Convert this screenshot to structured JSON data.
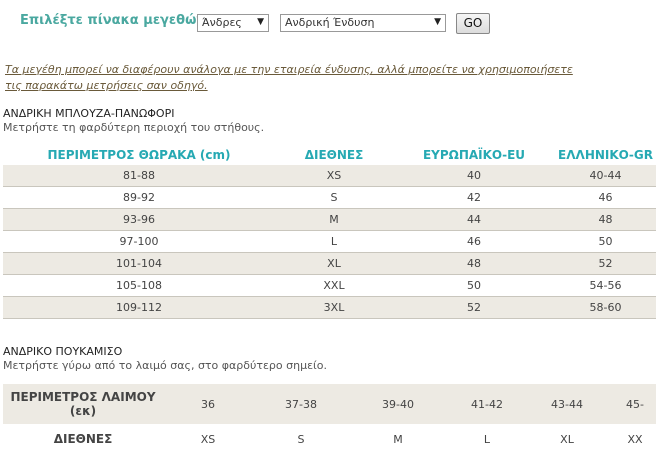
{
  "selector": {
    "label": "Επιλέξτε πίνακα μεγεθών:",
    "gender_value": "Άνδρες",
    "category_value": "Ανδρική Ένδυση",
    "go_label": "GO"
  },
  "notice": {
    "line1": "Τα μεγέθη μπορεί να διαφέρουν ανάλογα με την εταιρεία ένδυσης, αλλά μπορείτε να χρησιμοποιήσετε",
    "line2": "τις παρακάτω μετρήσεις σαν οδηγό."
  },
  "shirt_section": {
    "title": "ΑΝΔΡΙΚΗ ΜΠΛΟΥΖΑ-ΠΑΝΩΦΟΡΙ",
    "description": "Μετρήστε τη φαρδύτερη περιοχή του στήθους.",
    "headers": [
      "ΠΕΡΙΜΕΤΡΟΣ ΘΩΡΑΚΑ (cm)",
      "ΔΙΕΘΝΕΣ",
      "ΕΥΡΩΠΑΪΚΟ-EU",
      "ΕΛΛΗΝΙΚΟ-GR"
    ],
    "rows": [
      [
        "81-88",
        "XS",
        "40",
        "40-44"
      ],
      [
        "89-92",
        "S",
        "42",
        "46"
      ],
      [
        "93-96",
        "M",
        "44",
        "48"
      ],
      [
        "97-100",
        "L",
        "46",
        "50"
      ],
      [
        "101-104",
        "XL",
        "48",
        "52"
      ],
      [
        "105-108",
        "XXL",
        "50",
        "54-56"
      ],
      [
        "109-112",
        "3XL",
        "52",
        "58-60"
      ]
    ]
  },
  "collar_section": {
    "title": "ΑΝΔΡΙΚΟ ΠΟΥΚΑΜΙΣΟ",
    "description": "Μετρήστε γύρω από το λαιμό σας, στο φαρδύτερο σημείο.",
    "row1_header_line1": "ΠΕΡΙΜΕΤΡΟΣ ΛΑΙΜΟΥ",
    "row1_header_line2": "(εκ)",
    "row1": [
      "36",
      "37-38",
      "39-40",
      "41-42",
      "43-44",
      "45-"
    ],
    "row2_header": "ΔΙΕΘΝΕΣ",
    "row2": [
      "XS",
      "S",
      "M",
      "L",
      "XL",
      "XX"
    ]
  }
}
